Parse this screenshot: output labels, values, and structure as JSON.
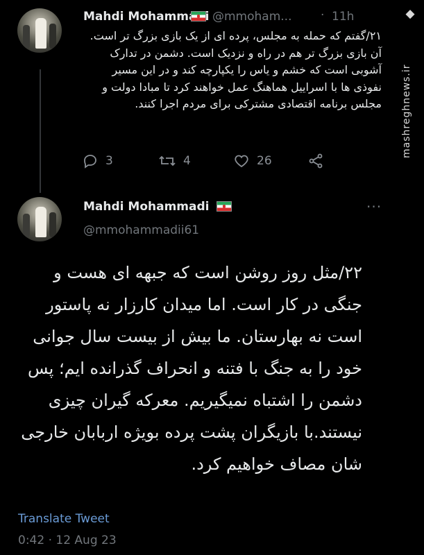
{
  "tweet1": {
    "author_name": "Mahdi Mohammadi",
    "handle": "@mmoham...",
    "time": "11h",
    "text": "۲۱/گفتم که حمله به مجلس، پرده ای از یک بازی بزرگ تر است. آن بازی بزرگ تر هم در راه و نزدیک است. دشمن در تدارک آشوبی است که خشم و یاس را یکپارچه کند و در این مسیر نفوذی ها با اسراییل هماهنگ عمل خواهند کرد تا مبادا دولت و مجلس برنامه اقتصادی مشترکی برای مردم اجرا کنند.",
    "reply_count": "3",
    "retweet_count": "4",
    "like_count": "26",
    "more_label": "···"
  },
  "tweet2": {
    "author_name": "Mahdi Mohammadi",
    "handle": "@mmohammadii61",
    "text": "۲۲/مثل روز روشن است که جبهه ای هست و جنگی در کار است. اما میدان کارزار نه پاستور است نه بهارستان. ما بیش از بیست سال جوانی خود را به جنگ با فتنه و انحراف گذرانده ایم؛ پس دشمن را اشتباه نمیگیریم. معرکه گیران چیزی نیستند.با بازیگران پشت پرده بویژه اربابان خارجی شان مصاف خواهیم کرد.",
    "translate_label": "Translate Tweet",
    "timestamp": "0:42 · 12 Aug 23",
    "more_label": "···"
  },
  "watermark": {
    "logo_text": "مشرق",
    "url": "mashreghnews.ir"
  },
  "icons": {
    "reply": "reply-icon",
    "retweet": "retweet-icon",
    "like": "heart-icon",
    "share": "share-icon",
    "flag": "iran-flag-icon",
    "more": "more-icon"
  }
}
